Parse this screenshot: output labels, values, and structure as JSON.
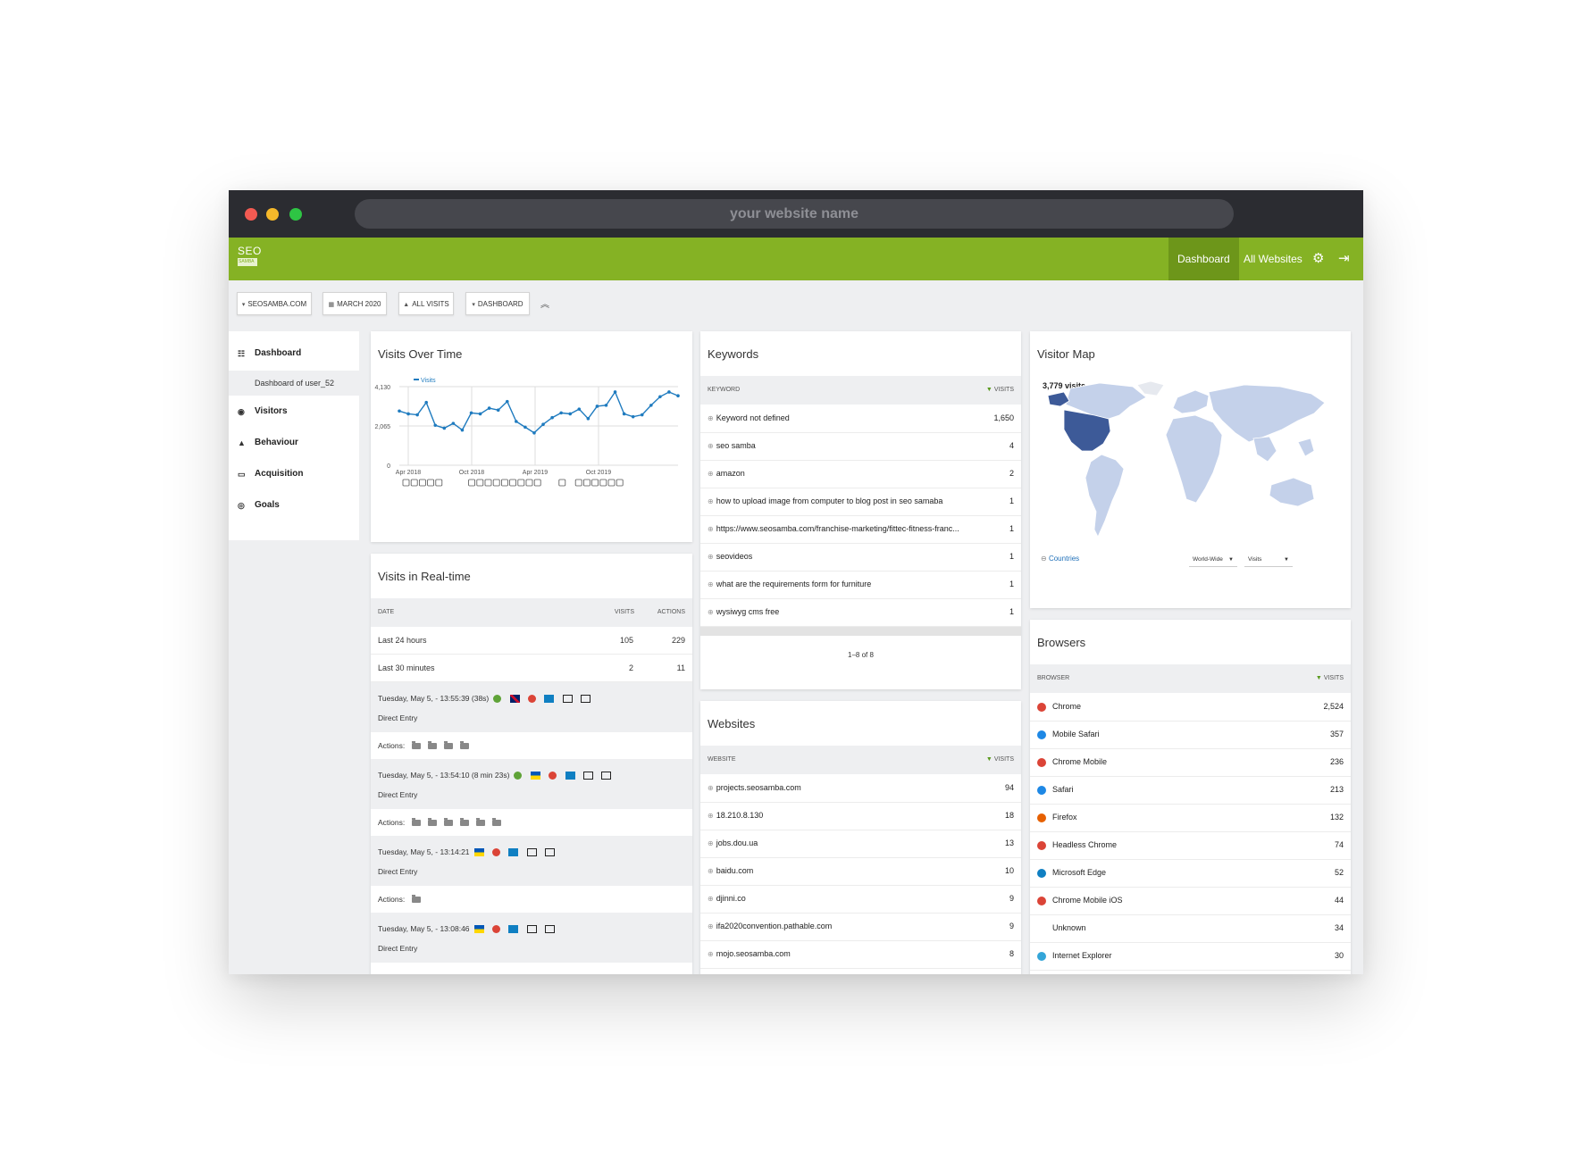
{
  "window": {
    "url_placeholder": "your website name"
  },
  "topnav": {
    "logo_top": "SEO",
    "logo_bottom": "SAMBA",
    "dashboard_label": "Dashboard",
    "all_websites_label": "All Websites",
    "settings_icon": "gear-icon",
    "logout_icon": "sign-out-icon",
    "accent_color": "#85b224"
  },
  "filters": {
    "site": "SEOSAMBA.COM",
    "date": "MARCH 2020",
    "segment": "ALL VISITS",
    "category": "DASHBOARD"
  },
  "sidebar": {
    "dashboard": "Dashboard",
    "dashboard_sub": "Dashboard of user_52",
    "visitors": "Visitors",
    "behaviour": "Behaviour",
    "acquisition": "Acquisition",
    "goals": "Goals"
  },
  "visits_over_time": {
    "title": "Visits Over Time",
    "chart_data": {
      "type": "line",
      "series": [
        {
          "name": "Visits",
          "color": "#1f7bbf",
          "values": [
            2850,
            2700,
            2650,
            3300,
            2100,
            1950,
            2200,
            1850,
            2750,
            2700,
            3000,
            2900,
            3350,
            2300,
            2000,
            1700,
            2150,
            2500,
            2750,
            2700,
            2950,
            2450,
            3100,
            3150,
            3850,
            2700,
            2550,
            2650,
            3150,
            3600,
            3850,
            3650
          ]
        },
        {
          "name": "",
          "values": []
        }
      ],
      "x_tick_labels": [
        "Apr 2018",
        "Oct 2018",
        "Apr 2019",
        "Oct 2019"
      ],
      "y_tick_labels": [
        "4,130",
        "2,065",
        "0"
      ],
      "ylim": [
        0,
        4130
      ]
    }
  },
  "realtime": {
    "title": "Visits in Real-time",
    "col_date": "DATE",
    "col_visits": "VISITS",
    "col_actions": "ACTIONS",
    "rows": [
      {
        "label": "Last 24 hours",
        "visits": "105",
        "actions": "229"
      },
      {
        "label": "Last 30 minutes",
        "visits": "2",
        "actions": "11"
      }
    ],
    "visits": [
      {
        "time": "Tuesday, May 5, - 13:55:39 (38s)",
        "entry": "Direct Entry",
        "actions_label": "Actions:"
      },
      {
        "time": "Tuesday, May 5, - 13:54:10 (8 min 23s)",
        "entry": "Direct Entry",
        "actions_label": "Actions:"
      },
      {
        "time": "Tuesday, May 5, - 13:14:21",
        "entry": "Direct Entry",
        "actions_label": "Actions:"
      },
      {
        "time": "Tuesday, May 5, - 13:08:46",
        "entry": "Direct Entry"
      }
    ]
  },
  "keywords": {
    "title": "Keywords",
    "col_keyword": "KEYWORD",
    "col_visits": "VISITS",
    "rows": [
      {
        "label": "Keyword not defined",
        "value": "1,650"
      },
      {
        "label": "seo samba",
        "value": "4"
      },
      {
        "label": "amazon",
        "value": "2"
      },
      {
        "label": "how to upload image from computer to blog post in seo samaba",
        "value": "1"
      },
      {
        "label": "https://www.seosamba.com/franchise-marketing/fittec-fitness-franc...",
        "value": "1"
      },
      {
        "label": "seovideos",
        "value": "1"
      },
      {
        "label": "what are the requirements form for furniture",
        "value": "1"
      },
      {
        "label": "wysiwyg cms free",
        "value": "1"
      }
    ],
    "pager": "1–8 of 8"
  },
  "websites": {
    "title": "Websites",
    "col_website": "WEBSITE",
    "col_visits": "VISITS",
    "rows": [
      {
        "label": "projects.seosamba.com",
        "value": "94"
      },
      {
        "label": "18.210.8.130",
        "value": "18"
      },
      {
        "label": "jobs.dou.ua",
        "value": "13"
      },
      {
        "label": "baidu.com",
        "value": "10"
      },
      {
        "label": "djinni.co",
        "value": "9"
      },
      {
        "label": "ifa2020convention.pathable.com",
        "value": "9"
      },
      {
        "label": "mojo.seosamba.com",
        "value": "8"
      }
    ]
  },
  "visitor_map": {
    "title": "Visitor Map",
    "visits_label": "3,779 visits",
    "countries_link": "Countries",
    "region_select": "World-Wide",
    "metric_select": "Visits",
    "highlight_color": "#3d5a98"
  },
  "browsers": {
    "title": "Browsers",
    "col_browser": "BROWSER",
    "col_visits": "VISITS",
    "rows": [
      {
        "label": "Chrome",
        "value": "2,524",
        "icon": "chrome-icon",
        "color": "#db4437"
      },
      {
        "label": "Mobile Safari",
        "value": "357",
        "icon": "safari-icon",
        "color": "#1e88e5"
      },
      {
        "label": "Chrome Mobile",
        "value": "236",
        "icon": "chrome-icon",
        "color": "#db4437"
      },
      {
        "label": "Safari",
        "value": "213",
        "icon": "safari-icon",
        "color": "#1e88e5"
      },
      {
        "label": "Firefox",
        "value": "132",
        "icon": "firefox-icon",
        "color": "#e66000"
      },
      {
        "label": "Headless Chrome",
        "value": "74",
        "icon": "chrome-icon",
        "color": "#db4437"
      },
      {
        "label": "Microsoft Edge",
        "value": "52",
        "icon": "edge-icon",
        "color": "#0f7fc2"
      },
      {
        "label": "Chrome Mobile iOS",
        "value": "44",
        "icon": "chrome-icon",
        "color": "#db4437"
      },
      {
        "label": "Unknown",
        "value": "34",
        "icon": "",
        "color": "transparent"
      },
      {
        "label": "Internet Explorer",
        "value": "30",
        "icon": "ie-icon",
        "color": "#34a5d8"
      }
    ]
  }
}
